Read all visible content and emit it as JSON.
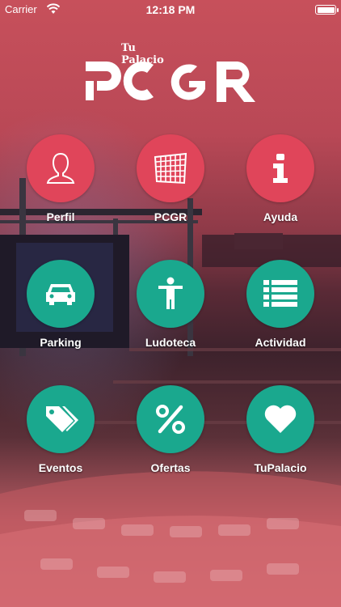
{
  "status_bar": {
    "carrier": "Carrier",
    "time": "12:18 PM"
  },
  "logo": {
    "line1": "Tu",
    "line2": "Palacio",
    "wordmark": "PCGR"
  },
  "menu": [
    {
      "label": "Perfil",
      "icon": "person-icon",
      "color": "#e0455a"
    },
    {
      "label": "PCGR",
      "icon": "building-grid-icon",
      "color": "#e0455a"
    },
    {
      "label": "Ayuda",
      "icon": "info-icon",
      "color": "#e0455a"
    },
    {
      "label": "Parking",
      "icon": "car-icon",
      "color": "#1aa88e"
    },
    {
      "label": "Ludoteca",
      "icon": "child-figure-icon",
      "color": "#1aa88e"
    },
    {
      "label": "Actividad",
      "icon": "list-icon",
      "color": "#1aa88e"
    },
    {
      "label": "Eventos",
      "icon": "tags-icon",
      "color": "#1aa88e"
    },
    {
      "label": "Ofertas",
      "icon": "percent-icon",
      "color": "#1aa88e"
    },
    {
      "label": "TuPalacio",
      "icon": "heart-icon",
      "color": "#1aa88e"
    }
  ]
}
